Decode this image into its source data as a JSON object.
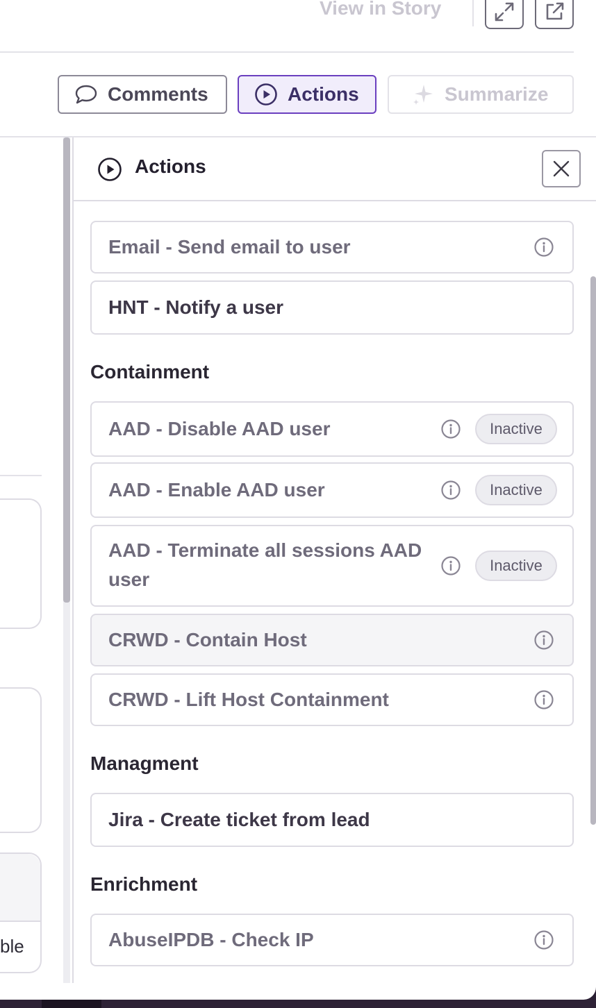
{
  "header": {
    "view_story_label": "View in Story",
    "expand_icon": "expand-icon",
    "external_icon": "external-link-icon"
  },
  "toolbar": {
    "comments_label": "Comments",
    "actions_label": "Actions",
    "summarize_label": "Summarize",
    "active_tab": "Actions",
    "accent_color": "#6a3fbf"
  },
  "left_pane": {
    "partial_text": "ble"
  },
  "panel": {
    "title": "Actions",
    "items_top": [
      {
        "label": "Email - Send email to user",
        "info": true,
        "status": ""
      },
      {
        "label": "HNT - Notify a user",
        "info": false,
        "status": ""
      }
    ],
    "sections": [
      {
        "title": "Containment",
        "items": [
          {
            "label": "AAD - Disable AAD user",
            "status": "Inactive"
          },
          {
            "label": "AAD - Enable AAD user",
            "status": "Inactive"
          },
          {
            "label": "AAD - Terminate all sessions AAD user",
            "status": "Inactive"
          },
          {
            "label": "CRWD - Contain Host",
            "status": ""
          },
          {
            "label": "CRWD - Lift Host Containment",
            "status": ""
          }
        ]
      },
      {
        "title": "Managment",
        "items": [
          {
            "label": "Jira - Create ticket from lead",
            "status": ""
          }
        ]
      },
      {
        "title": "Enrichment",
        "items": [
          {
            "label": "AbuseIPDB - Check IP",
            "status": ""
          }
        ]
      }
    ]
  }
}
